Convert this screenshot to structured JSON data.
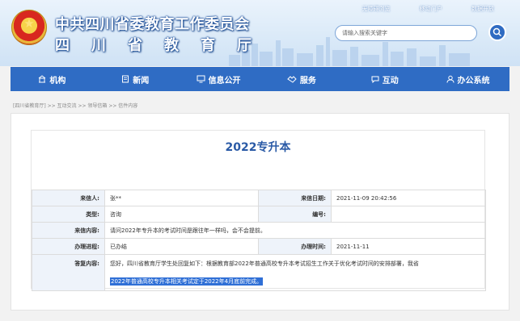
{
  "header": {
    "title_line1": "中共四川省委教育工作委员会",
    "title_line2": "四川省教育厅",
    "top_links": [
      "无障碍浏览",
      "移动门户",
      "数据开放"
    ],
    "search_placeholder": "请输入搜索关键字"
  },
  "nav": {
    "items": [
      {
        "label": "机构",
        "icon": "building-icon"
      },
      {
        "label": "新闻",
        "icon": "news-icon"
      },
      {
        "label": "信息公开",
        "icon": "monitor-icon"
      },
      {
        "label": "服务",
        "icon": "handshake-icon"
      },
      {
        "label": "互动",
        "icon": "chat-icon"
      },
      {
        "label": "办公系统",
        "icon": "user-icon"
      }
    ]
  },
  "breadcrumb": "[四川省教育厅] >> 互动交流 >> 领导信箱 >> 信件内容",
  "letter": {
    "title": "2022专升本",
    "sender_label": "来信人:",
    "sender_value": "张**",
    "date_label": "来信日期:",
    "date_value": "2021-11-09 20:42:56",
    "type_label": "类型:",
    "type_value": "咨询",
    "number_label": "编号:",
    "number_value": "",
    "content_label": "来信内容:",
    "content_value": "请问2022年专升本的考试时间是跟往年一样吗，会不会提前。",
    "progress_label": "办理进程:",
    "progress_value": "已办结",
    "handle_time_label": "办理时间:",
    "handle_time_value": "2021-11-11",
    "reply_label": "答复内容:",
    "reply_line1": "您好，四川省教育厅学生处回复如下：根据教育部2022年普通高校专升本考试招生工作关于优化考试时间的安排部署，我省",
    "reply_line2_highlight": "2022年普通高校专升本相关考试定于2022年4月底前完成。"
  },
  "colors": {
    "nav_bg": "#2f6cc4",
    "title_blue": "#2a5aa6",
    "label_bg": "#eef3fa",
    "highlight": "#2f6fd6"
  }
}
